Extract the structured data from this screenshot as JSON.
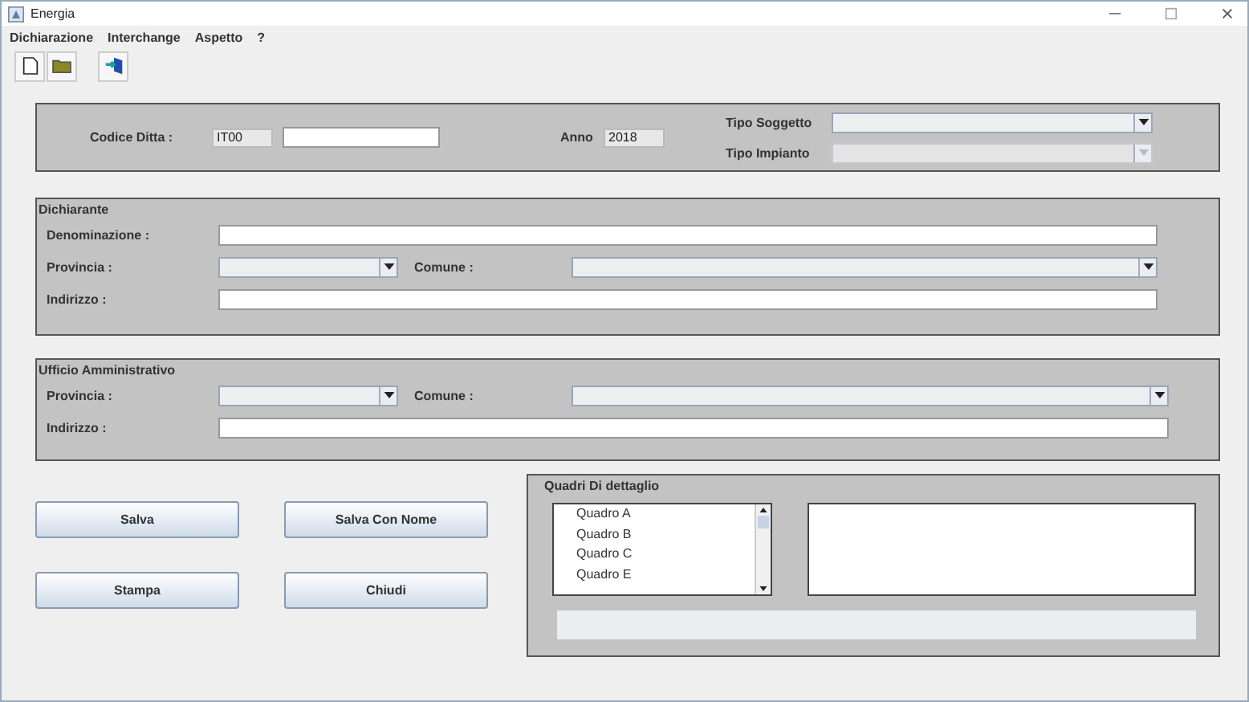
{
  "window": {
    "title": "Energia"
  },
  "menu": [
    "Dichiarazione",
    "Interchange",
    "Aspetto",
    "?"
  ],
  "header": {
    "codice_label": "Codice Ditta :",
    "codice_prefix": "IT00",
    "anno_label": "Anno",
    "anno_value": "2018",
    "combos": [
      {
        "label": "Tipo Soggetto",
        "disabled": false
      },
      {
        "label": "Tipo Impianto",
        "disabled": true
      }
    ]
  },
  "dichiarante": {
    "title": "Dichiarante",
    "denominazione_label": "Denominazione :",
    "provincia_label": "Provincia :",
    "comune_label": "Comune :",
    "indirizzo_label": "Indirizzo :"
  },
  "ufficio": {
    "title": "Ufficio Amministrativo",
    "provincia_label": "Provincia :",
    "comune_label": "Comune :",
    "indirizzo_label": "Indirizzo :"
  },
  "buttons": [
    "Salva",
    "Salva Con Nome",
    "Stampa",
    "Chiudi"
  ],
  "quadri": {
    "title": "Quadri Di dettaglio",
    "items": [
      "Quadro A",
      "Quadro B",
      "Quadro C",
      "Quadro E"
    ]
  }
}
